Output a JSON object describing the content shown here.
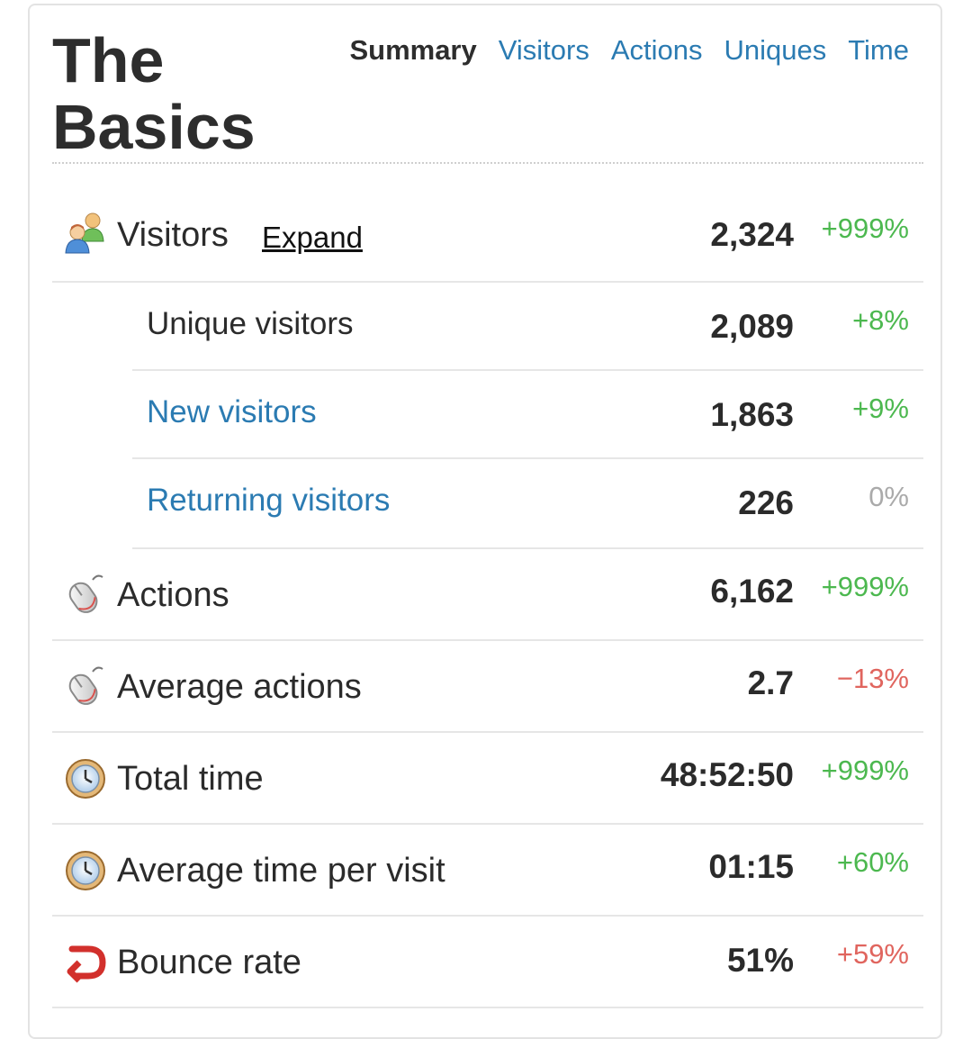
{
  "title": "The Basics",
  "tabs": [
    {
      "label": "Summary",
      "active": true
    },
    {
      "label": "Visitors",
      "active": false
    },
    {
      "label": "Actions",
      "active": false
    },
    {
      "label": "Uniques",
      "active": false
    },
    {
      "label": "Time",
      "active": false
    }
  ],
  "expand_label": "Expand",
  "colors": {
    "link": "#2b7bb2",
    "positive": "#4cb84f",
    "negative": "#e0655e",
    "neutral": "#aaaaaa"
  },
  "rows": [
    {
      "label": "Visitors",
      "value": "2,324",
      "change": "+999%",
      "trend": "positive",
      "icon": "visitors-icon"
    },
    {
      "label": "Unique visitors",
      "value": "2,089",
      "change": "+8%",
      "trend": "positive"
    },
    {
      "label": "New visitors",
      "value": "1,863",
      "change": "+9%",
      "trend": "positive"
    },
    {
      "label": "Returning visitors",
      "value": "226",
      "change": "0%",
      "trend": "neutral"
    },
    {
      "label": "Actions",
      "value": "6,162",
      "change": "+999%",
      "trend": "positive",
      "icon": "mouse-icon"
    },
    {
      "label": "Average actions",
      "value": "2.7",
      "change": "−13%",
      "trend": "negative",
      "icon": "mouse-icon"
    },
    {
      "label": "Total time",
      "value": "48:52:50",
      "change": "+999%",
      "trend": "positive",
      "icon": "clock-icon"
    },
    {
      "label": "Average time per visit",
      "value": "01:15",
      "change": "+60%",
      "trend": "positive",
      "icon": "clock-icon"
    },
    {
      "label": "Bounce rate",
      "value": "51%",
      "change": "+59%",
      "trend": "negative",
      "icon": "bounce-icon"
    }
  ]
}
